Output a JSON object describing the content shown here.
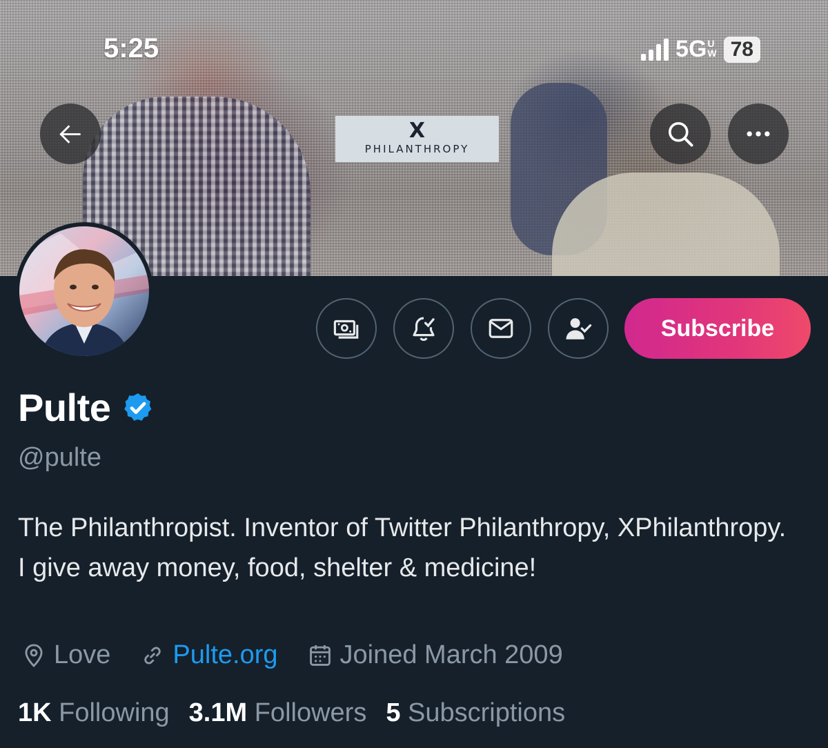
{
  "status_bar": {
    "time": "5:25",
    "network": "5G",
    "network_suffix_top": "U",
    "network_suffix_bottom": "W",
    "battery": "78"
  },
  "banner": {
    "logo_x": "X",
    "logo_word": "PHILANTHROPY"
  },
  "icons": {
    "back": "arrow-left-icon",
    "search": "search-icon",
    "more": "more-dots-icon",
    "tip": "money-icon",
    "notify": "bell-check-icon",
    "message": "envelope-icon",
    "follow": "person-check-icon",
    "verified": "verified-badge-icon",
    "location": "location-pin-icon",
    "link": "link-icon",
    "calendar": "calendar-icon"
  },
  "colors": {
    "background": "#15202b",
    "accent_link": "#1d9bf0",
    "subscribe_gradient_start": "#d1288f",
    "subscribe_gradient_end": "#ee4a6a",
    "secondary_text": "#8b98a5"
  },
  "actions": {
    "subscribe_label": "Subscribe"
  },
  "profile": {
    "name": "Pulte",
    "handle": "@pulte",
    "bio": "The Philanthropist. Inventor of Twitter Philanthropy, XPhilanthropy. I give away money, food, shelter & medicine!",
    "location": "Love",
    "website": "Pulte.org",
    "joined": "Joined March 2009"
  },
  "stats": {
    "following_count": "1K",
    "following_label": "Following",
    "followers_count": "3.1M",
    "followers_label": "Followers",
    "subscriptions_count": "5",
    "subscriptions_label": "Subscriptions"
  }
}
